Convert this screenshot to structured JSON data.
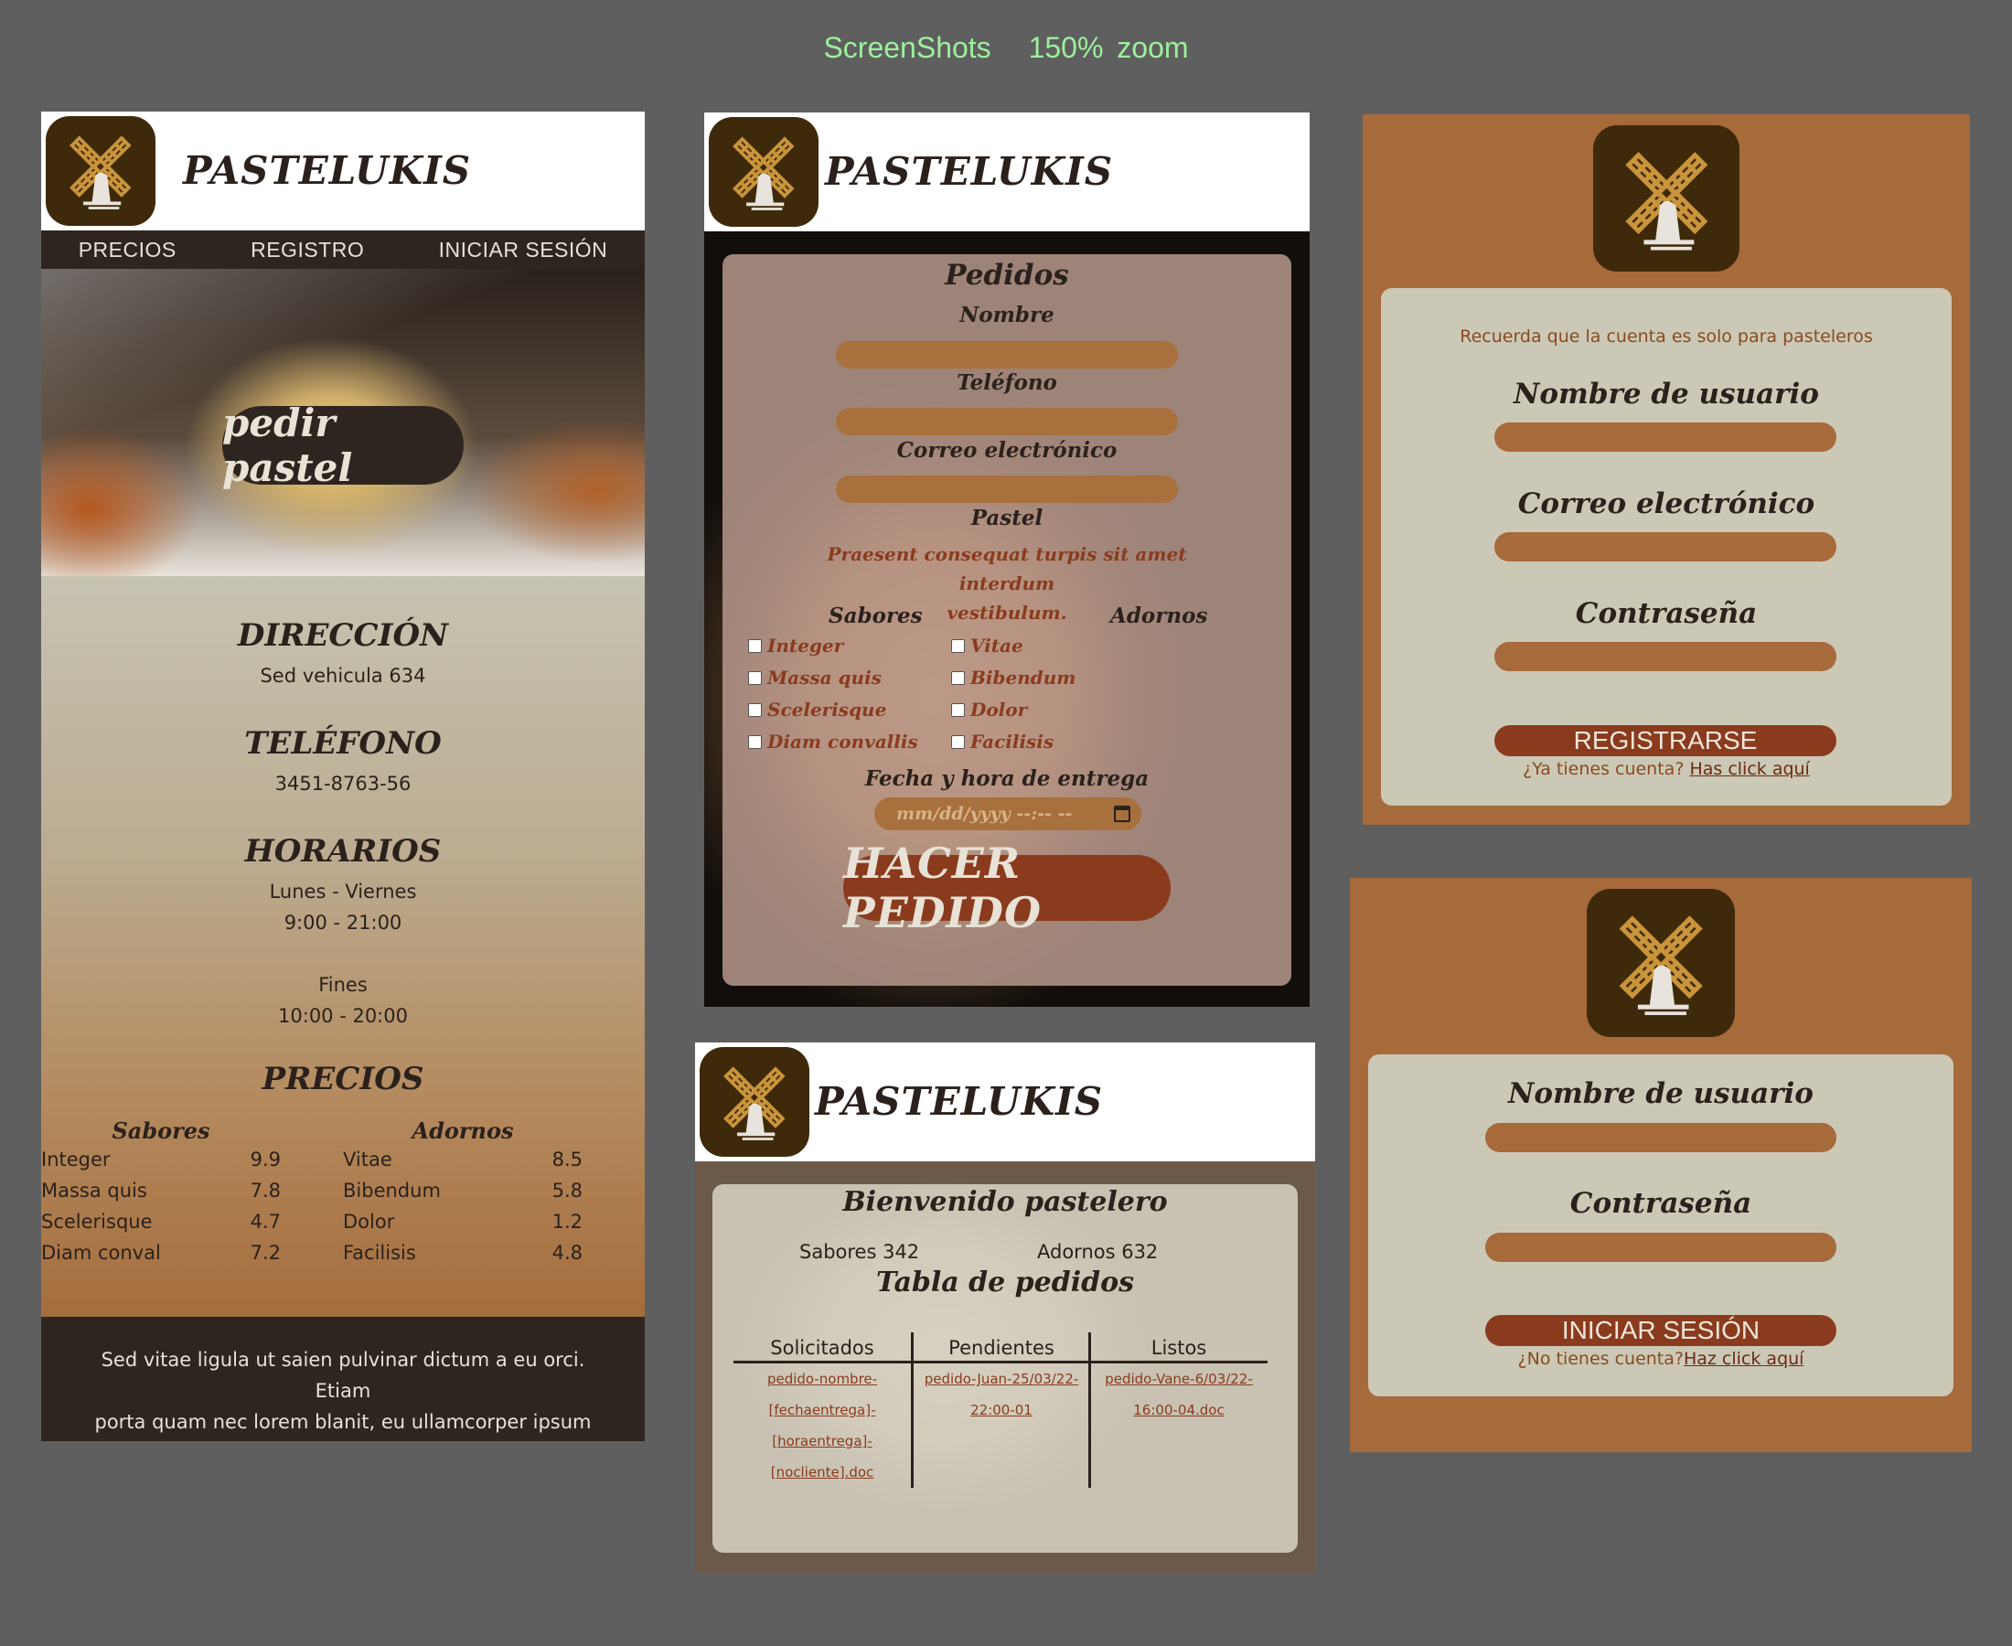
{
  "caption": {
    "left": "ScreenShots",
    "right": "150% zoom"
  },
  "brand": "PASTELUKIS",
  "home": {
    "nav": [
      "PRECIOS",
      "REGISTRO",
      "INICIAR SESIÓN"
    ],
    "cta": "pedir pastel",
    "direccion_title": "DIRECCIÓN",
    "direccion": "Sed vehicula 634",
    "telefono_title": "TELÉFONO",
    "telefono": "3451-8763-56",
    "horarios_title": "HORARIOS",
    "horario_semana_dias": "Lunes - Viernes",
    "horario_semana_horas": "9:00 - 21:00",
    "horario_fines_dias": "Fines",
    "horario_fines_horas": "10:00 - 20:00",
    "precios_title": "PRECIOS",
    "sabores_title": "Sabores",
    "adornos_title": "Adornos",
    "sabores": [
      {
        "name": "Integer",
        "price": "9.9"
      },
      {
        "name": "Massa quis",
        "price": "7.8"
      },
      {
        "name": "Scelerisque",
        "price": "4.7"
      },
      {
        "name": "Diam conval",
        "price": "7.2"
      }
    ],
    "adornos": [
      {
        "name": "Vitae",
        "price": "8.5"
      },
      {
        "name": "Bibendum",
        "price": "5.8"
      },
      {
        "name": "Dolor",
        "price": "1.2"
      },
      {
        "name": "Facilisis",
        "price": "4.8"
      }
    ],
    "footer_line1": "Sed vitae ligula ut saien pulvinar dictum a eu orci. Etiam",
    "footer_line2": "porta quam nec lorem blanit, eu ullamcorper ipsum varius"
  },
  "order": {
    "title": "Pedidos",
    "nombre": "Nombre",
    "telefono": "Teléfono",
    "correo": "Correo electrónico",
    "pastel": "Pastel",
    "desc_line1": "Praesent consequat turpis sit amet interdum",
    "desc_line2": "vestibulum.",
    "sabores_title": "Sabores",
    "adornos_title": "Adornos",
    "sabores": [
      "Integer",
      "Massa quis",
      "Scelerisque",
      "Diam convallis"
    ],
    "adornos": [
      "Vitae",
      "Bibendum",
      "Dolor",
      "Facilisis"
    ],
    "fecha_label": "Fecha y hora de entrega",
    "fecha_placeholder": "mm/dd/yyyy --:-- --",
    "submit": "HACER PEDIDO"
  },
  "dashboard": {
    "welcome": "Bienvenido pastelero",
    "sabores_count": "Sabores 342",
    "adornos_count": "Adornos 632",
    "table_title": "Tabla de pedidos",
    "columns": [
      "Solicitados",
      "Pendientes",
      "Listos"
    ],
    "solicitados": [
      "pedido-nombre-",
      "[fechaentrega]-",
      "[horaentrega]-",
      "[nocliente].doc"
    ],
    "pendientes": [
      "pedido-Juan-25/03/22-",
      "22:00-01"
    ],
    "listos": [
      "pedido-Vane-6/03/22-",
      "16:00-04.doc"
    ]
  },
  "register": {
    "note": "Recuerda que la cuenta es solo para pasteleros",
    "username": "Nombre de usuario",
    "email": "Correo electrónico",
    "password": "Contraseña",
    "button": "REGISTRARSE",
    "prompt": "¿Ya tienes cuenta?",
    "link": "Has click aquí"
  },
  "login": {
    "username": "Nombre de usuario",
    "password": "Contraseña",
    "button": "INICIAR SESIÓN",
    "prompt": "¿No tienes cuenta?",
    "link": "Haz click aquí"
  },
  "colors": {
    "background": "#5f5f5f",
    "dark": "#2f2520",
    "brown": "#a66a3b",
    "rust": "#8a3b1e",
    "card": "#ccc8b6",
    "logo_bg": "#3e2a0a",
    "logo_mark": "#c9943a"
  },
  "icons": {
    "logo": "windmill-icon",
    "calendar": "calendar-icon"
  }
}
